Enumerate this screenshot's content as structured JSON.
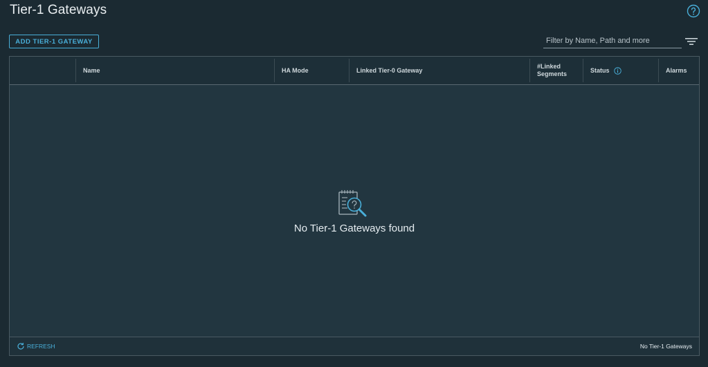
{
  "page": {
    "title": "Tier-1 Gateways",
    "help_icon": "help-circle-icon"
  },
  "toolbar": {
    "add_label": "ADD TIER-1 GATEWAY",
    "filter_placeholder": "Filter by Name, Path and more",
    "filter_icon": "filter-lines-icon"
  },
  "table": {
    "columns": [
      {
        "label": ""
      },
      {
        "label": "Name"
      },
      {
        "label": "HA Mode"
      },
      {
        "label": "Linked Tier-0 Gateway"
      },
      {
        "label": "#Linked Segments",
        "line1": "#Linked",
        "line2": "Segments"
      },
      {
        "label": "Status"
      },
      {
        "label": "Alarms"
      }
    ],
    "rows": [],
    "empty_message": "No Tier-1 Gateways found",
    "empty_icon": "clipboard-search-icon"
  },
  "footer": {
    "refresh_label": "REFRESH",
    "refresh_icon": "refresh-icon",
    "count_text": "No Tier-1 Gateways"
  },
  "colors": {
    "background": "#1b2a32",
    "accent": "#49afd9",
    "grid_body": "#223640"
  }
}
